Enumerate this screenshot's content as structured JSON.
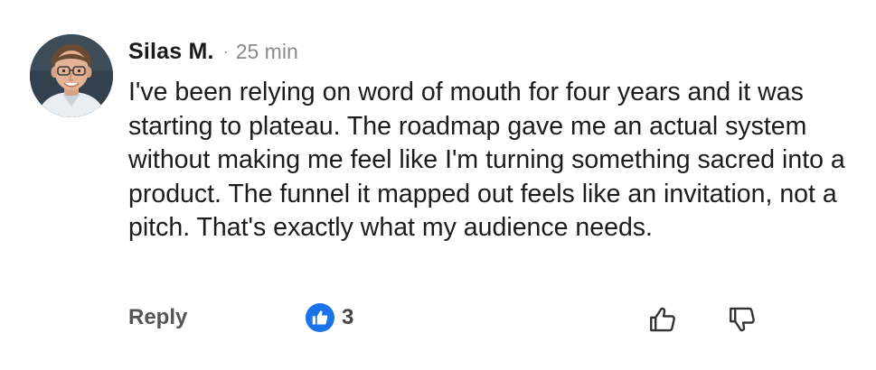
{
  "comment": {
    "author": "Silas M.",
    "separator": "·",
    "timestamp": "25 min",
    "text": "I've been relying on word of mouth for four years and it was starting to plateau. The roadmap gave me an actual system without making me feel like I'm turning something sacred into a product. The funnel it mapped out feels like an invitation, not a pitch. That's exactly what my audience needs.",
    "avatar_icon": "user-avatar-photo"
  },
  "actions": {
    "reply_label": "Reply",
    "reaction_icon": "thumbs-up-icon",
    "reaction_count": "3",
    "upvote_icon": "thumbs-up-outline-icon",
    "downvote_icon": "thumbs-down-outline-icon"
  },
  "colors": {
    "reaction_badge": "#1a73e8",
    "author_text": "#1a1a1a",
    "meta_text": "#8a8a8a",
    "action_text": "#555555"
  }
}
